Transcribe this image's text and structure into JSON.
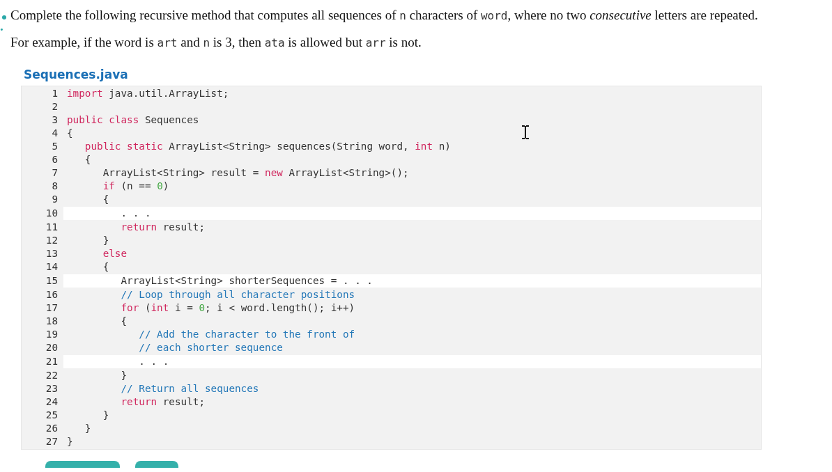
{
  "question": {
    "number": ".",
    "prompt": [
      {
        "kind": "text",
        "text": "Complete the following recursive method that computes all sequences of "
      },
      {
        "kind": "code",
        "text": "n"
      },
      {
        "kind": "text",
        "text": " characters of "
      },
      {
        "kind": "code",
        "text": "word"
      },
      {
        "kind": "text",
        "text": ", where no two "
      },
      {
        "kind": "em",
        "text": "consecutive"
      },
      {
        "kind": "text",
        "text": " letters are repeated."
      }
    ],
    "example": [
      {
        "kind": "text",
        "text": "For example, if the word is "
      },
      {
        "kind": "code",
        "text": "art"
      },
      {
        "kind": "text",
        "text": " and "
      },
      {
        "kind": "code",
        "text": "n"
      },
      {
        "kind": "text",
        "text": " is 3, then "
      },
      {
        "kind": "code",
        "text": "ata"
      },
      {
        "kind": "text",
        "text": " is allowed but "
      },
      {
        "kind": "code",
        "text": "arr"
      },
      {
        "kind": "text",
        "text": " is not."
      }
    ]
  },
  "file": {
    "name": "Sequences.java",
    "lines": [
      {
        "number": "1",
        "editable": false,
        "tokens": [
          {
            "kind": "keyword",
            "text": "import"
          },
          {
            "kind": "plain",
            "text": " java.util.ArrayList;"
          }
        ]
      },
      {
        "number": "2",
        "editable": false
      },
      {
        "number": "3",
        "editable": false,
        "tokens": [
          {
            "kind": "keyword",
            "text": "public class"
          },
          {
            "kind": "plain",
            "text": " Sequences"
          }
        ]
      },
      {
        "number": "4",
        "editable": false,
        "tokens": [
          {
            "kind": "plain",
            "text": "{"
          }
        ]
      },
      {
        "number": "5",
        "editable": false,
        "tokens": [
          {
            "kind": "keyword",
            "text": "   public static"
          },
          {
            "kind": "plain",
            "text": " ArrayList<String> sequences(String word, "
          },
          {
            "kind": "keyword",
            "text": "int"
          },
          {
            "kind": "plain",
            "text": " n)"
          }
        ]
      },
      {
        "number": "6",
        "editable": false,
        "tokens": [
          {
            "kind": "plain",
            "text": "   {"
          }
        ]
      },
      {
        "number": "7",
        "editable": false,
        "tokens": [
          {
            "kind": "plain",
            "text": "      ArrayList<String> result = "
          },
          {
            "kind": "keyword",
            "text": "new"
          },
          {
            "kind": "plain",
            "text": " ArrayList<String>();"
          }
        ]
      },
      {
        "number": "8",
        "editable": false,
        "tokens": [
          {
            "kind": "keyword",
            "text": "      if"
          },
          {
            "kind": "plain",
            "text": " (n == "
          },
          {
            "kind": "number",
            "text": "0"
          },
          {
            "kind": "plain",
            "text": ")"
          }
        ]
      },
      {
        "number": "9",
        "editable": false,
        "tokens": [
          {
            "kind": "plain",
            "text": "      {"
          }
        ]
      },
      {
        "number": "10",
        "editable": true,
        "tokens": [
          {
            "kind": "plain",
            "text": "         . . ."
          }
        ]
      },
      {
        "number": "11",
        "editable": false,
        "tokens": [
          {
            "kind": "keyword",
            "text": "         return"
          },
          {
            "kind": "plain",
            "text": " result;"
          }
        ]
      },
      {
        "number": "12",
        "editable": false,
        "tokens": [
          {
            "kind": "plain",
            "text": "      }"
          }
        ]
      },
      {
        "number": "13",
        "editable": false,
        "tokens": [
          {
            "kind": "keyword",
            "text": "      else"
          }
        ]
      },
      {
        "number": "14",
        "editable": false,
        "tokens": [
          {
            "kind": "plain",
            "text": "      {"
          }
        ]
      },
      {
        "number": "15",
        "editable": true,
        "tokens": [
          {
            "kind": "plain",
            "text": "         ArrayList<String> shorterSequences = . . ."
          }
        ]
      },
      {
        "number": "16",
        "editable": false,
        "tokens": [
          {
            "kind": "comment",
            "text": "         // Loop through all character positions"
          }
        ]
      },
      {
        "number": "17",
        "editable": false,
        "tokens": [
          {
            "kind": "keyword",
            "text": "         for"
          },
          {
            "kind": "plain",
            "text": " ("
          },
          {
            "kind": "keyword",
            "text": "int"
          },
          {
            "kind": "plain",
            "text": " i = "
          },
          {
            "kind": "number",
            "text": "0"
          },
          {
            "kind": "plain",
            "text": "; i < word.length(); i++)"
          }
        ]
      },
      {
        "number": "18",
        "editable": false,
        "tokens": [
          {
            "kind": "plain",
            "text": "         {"
          }
        ]
      },
      {
        "number": "19",
        "editable": false,
        "tokens": [
          {
            "kind": "comment",
            "text": "            // Add the character to the front of"
          }
        ]
      },
      {
        "number": "20",
        "editable": false,
        "tokens": [
          {
            "kind": "comment",
            "text": "            // each shorter sequence"
          }
        ]
      },
      {
        "number": "21",
        "editable": true,
        "tokens": [
          {
            "kind": "plain",
            "text": "            . . ."
          }
        ]
      },
      {
        "number": "22",
        "editable": false,
        "tokens": [
          {
            "kind": "plain",
            "text": "         }"
          }
        ]
      },
      {
        "number": "23",
        "editable": false,
        "tokens": [
          {
            "kind": "comment",
            "text": "         // Return all sequences"
          }
        ]
      },
      {
        "number": "24",
        "editable": false,
        "tokens": [
          {
            "kind": "keyword",
            "text": "         return"
          },
          {
            "kind": "plain",
            "text": " result;"
          }
        ]
      },
      {
        "number": "25",
        "editable": false,
        "tokens": [
          {
            "kind": "plain",
            "text": "      }"
          }
        ]
      },
      {
        "number": "26",
        "editable": false,
        "tokens": [
          {
            "kind": "plain",
            "text": "   }"
          }
        ]
      },
      {
        "number": "27",
        "editable": false,
        "tokens": [
          {
            "kind": "plain",
            "text": "}"
          }
        ]
      }
    ]
  },
  "buttons": [
    {
      "kind": "wide"
    },
    {
      "kind": "narrow"
    }
  ]
}
